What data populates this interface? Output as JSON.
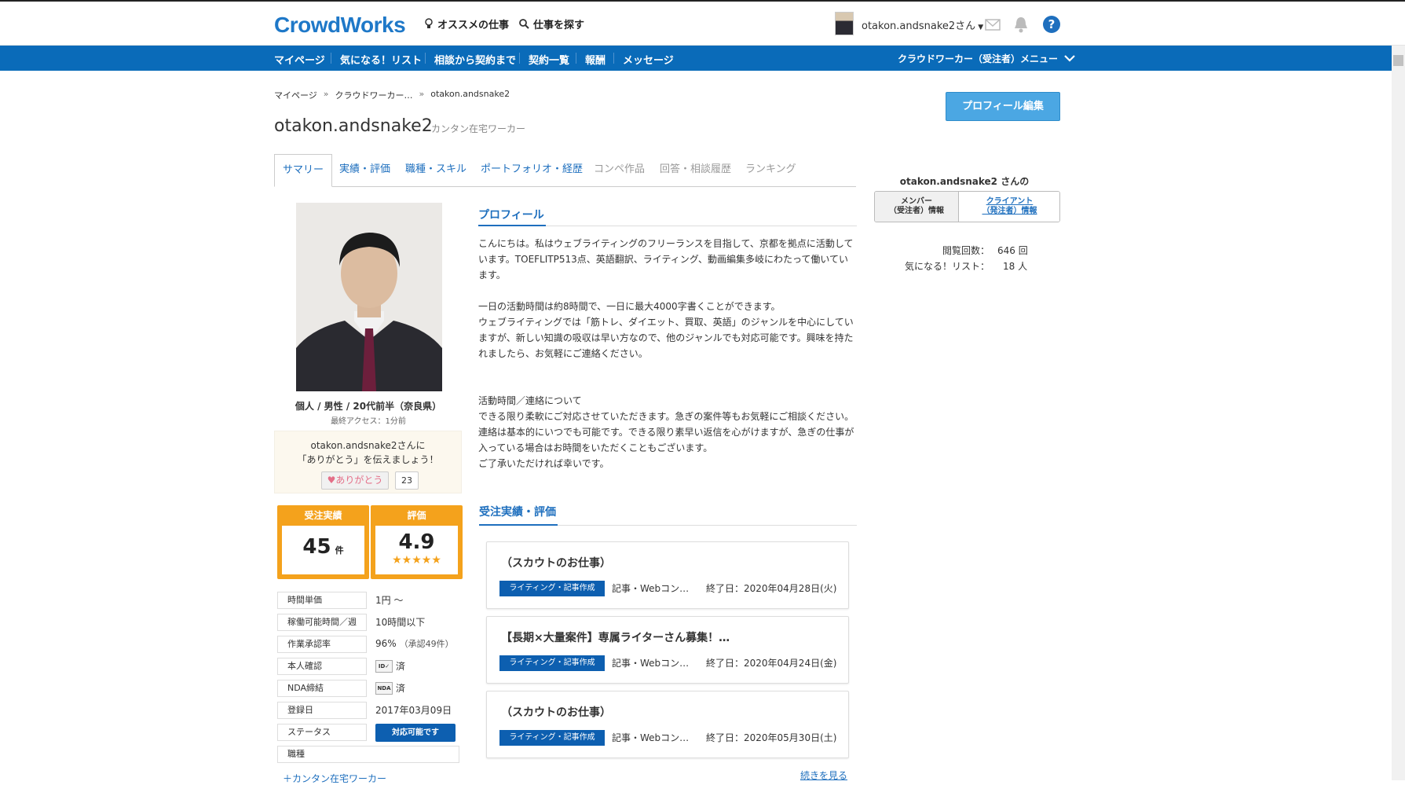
{
  "header": {
    "logo": "CrowdWorks",
    "recommend_label": "オススメの仕事",
    "search_label": "仕事を探す",
    "username": "otakon.andsnake2さん"
  },
  "nav": {
    "items": [
      "マイページ",
      "気になる！リスト",
      "相談から契約まで",
      "契約一覧",
      "報酬",
      "メッセージ"
    ],
    "menu_label": "クラウドワーカー（受注者）メニュー"
  },
  "breadcrumb": [
    "マイページ",
    "クラウドワーカー…",
    "otakon.andsnake2"
  ],
  "profile": {
    "title": "otakon.andsnake2",
    "subtitle": "カンタン在宅ワーカー",
    "edit_button": "プロフィール編集",
    "demographics": "個人 / 男性 / 20代前半（奈良県）",
    "last_access": "最終アクセス：1分前"
  },
  "tabs": [
    "サマリー",
    "実績・評価",
    "職種・スキル",
    "ポートフォリオ・経歴",
    "コンペ作品",
    "回答・相談履歴",
    "ランキング"
  ],
  "thanks": {
    "line1": "otakon.andsnake2さんに",
    "line2": "「ありがとう」を伝えましょう！",
    "button": "ありがとう",
    "count": "23"
  },
  "stats": {
    "orders_label": "受注実績",
    "orders_value": "45",
    "orders_unit": "件",
    "rating_label": "評価",
    "rating_value": "4.9",
    "rating_stars": 5
  },
  "info": [
    {
      "label": "時間単価",
      "value": "1円 ～"
    },
    {
      "label": "稼働可能時間／週",
      "value": "10時間以下"
    },
    {
      "label": "作業承認率",
      "value": "96%",
      "extra": "（承認49件）"
    },
    {
      "label": "本人確認",
      "value": "済",
      "icon": "id-verified-icon"
    },
    {
      "label": "NDA締結",
      "value": "済",
      "icon": "nda-icon"
    },
    {
      "label": "登録日",
      "value": "2017年03月09日"
    },
    {
      "label": "ステータス",
      "value": "対応可能です"
    },
    {
      "label": "職種",
      "value": ""
    }
  ],
  "cut_link": "＋カンタン在宅ワーカー",
  "profile_section": {
    "heading": "プロフィール",
    "paragraphs": [
      "こんにちは。私はウェブライティングのフリーランスを目指して、京都を拠点に活動しています。TOEFLITP513点、英語翻訳、ライティング、動画編集多岐にわたって働いています。",
      "一日の活動時間は約8時間で、一日に最大4000字書くことができます。\nウェブライティングでは「筋トレ、ダイエット、買取、英語」のジャンルを中心にしていますが、新しい知識の吸収は早い方なので、他のジャンルでも対応可能です。興味を持たれましたら、お気軽にご連絡ください。",
      "活動時間／連絡について\nできる限り柔軟にご対応させていただきます。急ぎの案件等もお気軽にご相談ください。\n連絡は基本的にいつでも可能です。できる限り素早い返信を心がけますが、急ぎの仕事が入っている場合はお時間をいただくこともございます。\nご了承いただければ幸いです。"
    ]
  },
  "orders_section": {
    "heading": "受注実績・評価",
    "jobs": [
      {
        "title": "（スカウトのお仕事）",
        "tag": "ライティング・記事作成",
        "category": "記事・Webコン…",
        "date": "終了日：2020年04月28日(火)"
      },
      {
        "title": "【長期×大量案件】専属ライターさん募集！…",
        "tag": "ライティング・記事作成",
        "category": "記事・Webコン…",
        "date": "終了日：2020年04月24日(金)"
      },
      {
        "title": "（スカウトのお仕事）",
        "tag": "ライティング・記事作成",
        "category": "記事・Webコン…",
        "date": "終了日：2020年05月30日(土)"
      }
    ],
    "more_link": "続きを見る"
  },
  "sidebar": {
    "heading": "otakon.andsnake2 さんの",
    "member_info": "メンバー\n（受注者）情報",
    "client_info": "クライアント\n（発注者）情報",
    "views_label": "閲覧回数：",
    "views_value": "646 回",
    "watchlist_label": "気になる！リスト：",
    "watchlist_value": "18 人"
  },
  "colors": {
    "brand_blue": "#0a6bb9",
    "accent_orange": "#f4a21c",
    "link_blue": "#1e6fbe"
  }
}
